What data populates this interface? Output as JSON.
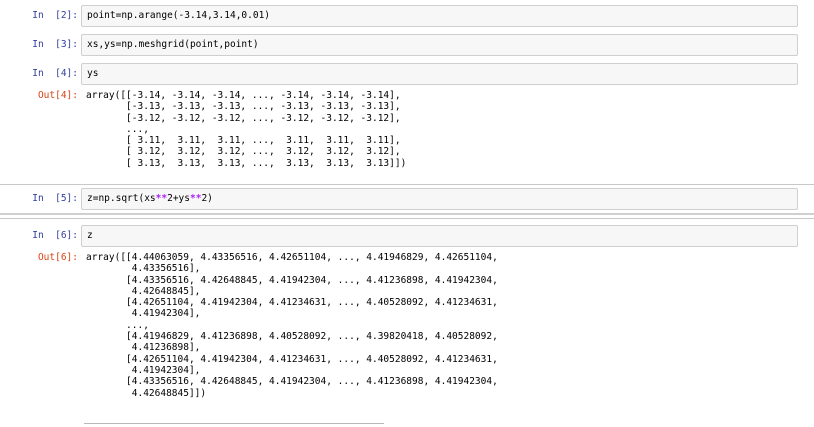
{
  "cells": {
    "c2": {
      "prompt": "In  [2]:",
      "code": "point=np.arange(-3.14,3.14,0.01)"
    },
    "c3": {
      "prompt": "In  [3]:",
      "code": "xs,ys=np.meshgrid(point,point)"
    },
    "c4": {
      "prompt": "In  [4]:",
      "code": "ys",
      "out_prompt": "Out[4]:",
      "output": "array([[-3.14, -3.14, -3.14, ..., -3.14, -3.14, -3.14],\n       [-3.13, -3.13, -3.13, ..., -3.13, -3.13, -3.13],\n       [-3.12, -3.12, -3.12, ..., -3.12, -3.12, -3.12],\n       ...,\n       [ 3.11,  3.11,  3.11, ...,  3.11,  3.11,  3.11],\n       [ 3.12,  3.12,  3.12, ...,  3.12,  3.12,  3.12],\n       [ 3.13,  3.13,  3.13, ...,  3.13,  3.13,  3.13]])"
    },
    "c5": {
      "prompt": "In  [5]:",
      "code_pre": "z=np.sqrt(xs",
      "code_op1": "**",
      "code_mid": "2+ys",
      "code_op2": "**",
      "code_post": "2)"
    },
    "c6": {
      "prompt": "In  [6]:",
      "code": "z",
      "out_prompt": "Out[6]:",
      "output": "array([[4.44063059, 4.43356516, 4.42651104, ..., 4.41946829, 4.42651104,\n        4.43356516],\n       [4.43356516, 4.42648845, 4.41942304, ..., 4.41236898, 4.41942304,\n        4.42648845],\n       [4.42651104, 4.41942304, 4.41234631, ..., 4.40528092, 4.41234631,\n        4.41942304],\n       ...,\n       [4.41946829, 4.41236898, 4.40528092, ..., 4.39820418, 4.40528092,\n        4.41236898],\n       [4.42651104, 4.41942304, 4.41234631, ..., 4.40528092, 4.41234631,\n        4.41942304],\n       [4.43356516, 4.42648845, 4.41942304, ..., 4.41236898, 4.41942304,\n        4.42648845]])"
    }
  },
  "colors": {
    "in_prompt": "#303f9f",
    "out_prompt": "#d84315",
    "operator": "#aa22ff",
    "input_bg": "#f7f7f7",
    "input_border": "#cfcfcf"
  }
}
